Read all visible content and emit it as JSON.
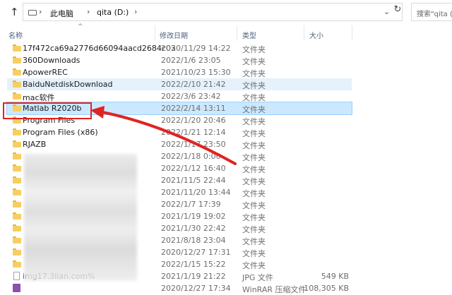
{
  "toolbar": {
    "up_glyph": "↑",
    "sep_glyph": "›",
    "breadcrumbs": [
      "此电脑",
      "qita (D:)"
    ],
    "dropdown_glyph": "⌄",
    "refresh_glyph": "↻",
    "search_placeholder": "搜索\"qita (D:)\""
  },
  "columns": {
    "name": "名称",
    "date": "修改日期",
    "type": "类型",
    "size": "大小",
    "sort_glyph": "^"
  },
  "rows": [
    {
      "name": "17f472ca69a2776d66094aacd2684c03",
      "date": "2020/11/29 14:22",
      "type": "文件夹",
      "size": "",
      "icon": "folder-icon",
      "state": "normal"
    },
    {
      "name": "360Downloads",
      "date": "2022/1/6 23:05",
      "type": "文件夹",
      "size": "",
      "icon": "folder-icon",
      "state": "normal"
    },
    {
      "name": "ApowerREC",
      "date": "2021/10/23 15:30",
      "type": "文件夹",
      "size": "",
      "icon": "folder-icon",
      "state": "normal"
    },
    {
      "name": "BaiduNetdiskDownload",
      "date": "2022/2/10 21:42",
      "type": "文件夹",
      "size": "",
      "icon": "folder-icon",
      "state": "hover"
    },
    {
      "name": "mac软件",
      "date": "2022/3/6 23:42",
      "type": "文件夹",
      "size": "",
      "icon": "folder-icon",
      "state": "normal"
    },
    {
      "name": "Matlab R2020b",
      "date": "2022/2/14 13:11",
      "type": "文件夹",
      "size": "",
      "icon": "folder-icon",
      "state": "selected"
    },
    {
      "name": "Program Files",
      "date": "2022/1/20 20:46",
      "type": "文件夹",
      "size": "",
      "icon": "folder-icon",
      "state": "normal"
    },
    {
      "name": "Program Files (x86)",
      "date": "2022/1/21 12:14",
      "type": "文件夹",
      "size": "",
      "icon": "folder-icon",
      "state": "normal"
    },
    {
      "name": "RJAZB",
      "date": "2022/1/17 23:50",
      "type": "文件夹",
      "size": "",
      "icon": "folder-icon",
      "state": "normal"
    },
    {
      "name": "",
      "date": "2022/1/18 0:00",
      "type": "文件夹",
      "size": "",
      "icon": "folder-icon",
      "state": "normal"
    },
    {
      "name": "",
      "date": "2022/1/12 16:40",
      "type": "文件夹",
      "size": "",
      "icon": "folder-icon",
      "state": "normal"
    },
    {
      "name": "",
      "date": "2021/11/5 22:44",
      "type": "文件夹",
      "size": "",
      "icon": "folder-icon",
      "state": "normal"
    },
    {
      "name": "",
      "date": "2021/11/20 13:44",
      "type": "文件夹",
      "size": "",
      "icon": "folder-icon",
      "state": "normal"
    },
    {
      "name": "",
      "date": "2022/1/7 17:39",
      "type": "文件夹",
      "size": "",
      "icon": "folder-icon",
      "state": "normal"
    },
    {
      "name": "",
      "date": "2021/1/19 19:02",
      "type": "文件夹",
      "size": "",
      "icon": "folder-icon",
      "state": "normal"
    },
    {
      "name": "",
      "date": "2021/1/30 22:42",
      "type": "文件夹",
      "size": "",
      "icon": "folder-icon",
      "state": "normal"
    },
    {
      "name": "",
      "date": "2021/8/18 23:04",
      "type": "文件夹",
      "size": "",
      "icon": "folder-icon",
      "state": "normal"
    },
    {
      "name": "",
      "date": "2020/12/27 17:31",
      "type": "文件夹",
      "size": "",
      "icon": "folder-icon",
      "state": "normal"
    },
    {
      "name": "",
      "date": "2022/1/15 15:22",
      "type": "文件夹",
      "size": "",
      "icon": "folder-icon",
      "state": "normal"
    },
    {
      "name": "img17.3lian.com%",
      "date": "2021/1/19 21:22",
      "type": "JPG 文件",
      "size": "549 KB",
      "icon": "file-icon",
      "state": "normal"
    },
    {
      "name": "",
      "date": "2020/12/27 17:34",
      "type": "WinRAR 压缩文件",
      "size": "108,305 KB",
      "icon": "archive-icon",
      "state": "normal"
    }
  ],
  "colors": {
    "annotation": "#e02323",
    "selected_bg": "#cce8ff",
    "hover_bg": "#e5f1fb",
    "folder": "#f5cf63"
  }
}
